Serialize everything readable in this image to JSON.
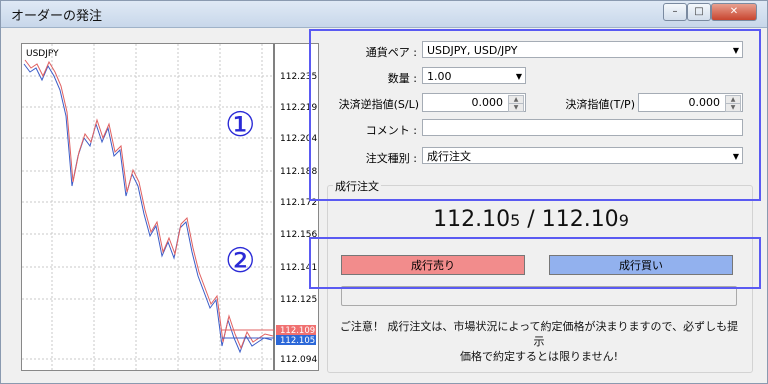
{
  "window": {
    "title": "オーダーの発注",
    "controls": [
      "–",
      "□",
      "✕"
    ]
  },
  "chart": {
    "symbol": "USDJPY",
    "y_ticks": [
      "112.235",
      "112.219",
      "112.204",
      "112.188",
      "112.172",
      "112.156",
      "112.141",
      "112.125",
      "112.109",
      "112.105",
      "112.094"
    ],
    "ask_label": "112.109",
    "bid_label": "112.105"
  },
  "form": {
    "pair_label": "通貨ペア :",
    "pair_value": "USDJPY, USD/JPY",
    "qty_label": "数量 :",
    "qty_value": "1.00",
    "sl_label": "決済逆指値(S/L)",
    "sl_value": "0.000",
    "tp_label": "決済指値(T/P)",
    "tp_value": "0.000",
    "comment_label": "コメント :",
    "comment_value": "",
    "type_label": "注文種別 :",
    "type_value": "成行注文"
  },
  "market": {
    "group_label": "成行注文",
    "bid_main": "112.10",
    "bid_small": "5",
    "separator": " / ",
    "ask_main": "112.10",
    "ask_small": "9",
    "sell_label": "成行売り",
    "buy_label": "成行買い",
    "notice_line1": "ご注意！ 成行注文は、市場状況によって約定価格が決まりますので、必ずしも提示",
    "notice_line2": "価格で約定するとは限りません!"
  },
  "annotations": {
    "marker1": "①",
    "marker2": "②"
  },
  "colors": {
    "sell": "#f28c8c",
    "buy": "#92b1ee",
    "highlight": "#5a5af2"
  }
}
